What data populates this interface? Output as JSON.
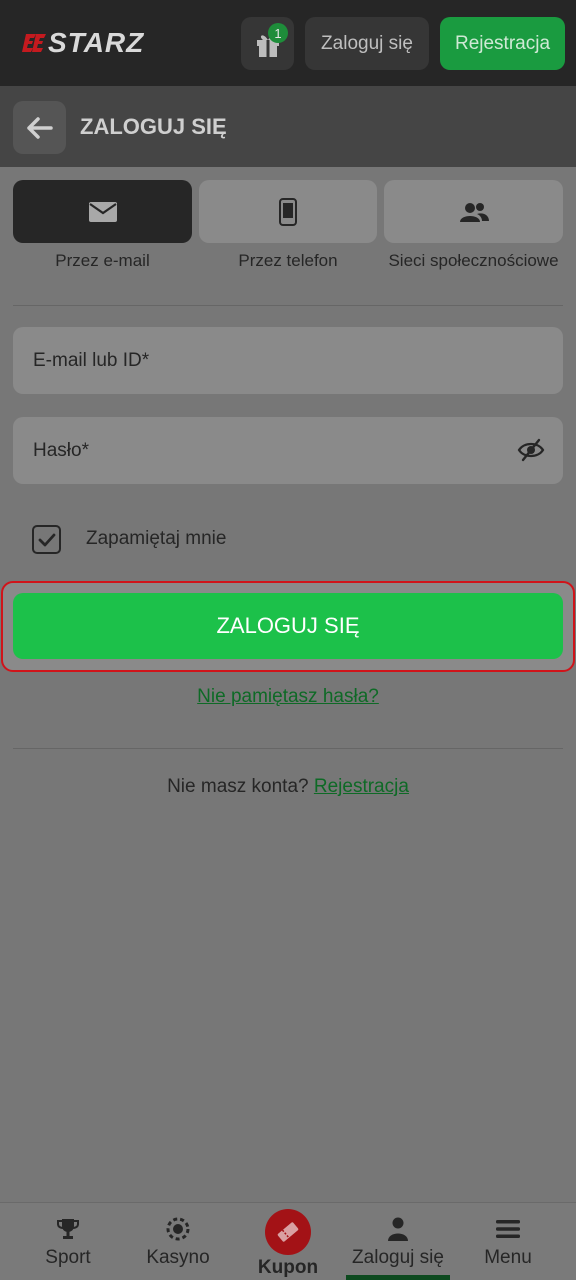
{
  "topbar": {
    "logo_text": "STARZ",
    "gift_badge": "1",
    "login_label": "Zaloguj się",
    "register_label": "Rejestracja"
  },
  "header": {
    "title": "ZALOGUJ SIĘ"
  },
  "methods": [
    {
      "label": "Przez e-mail",
      "icon": "envelope-icon",
      "active": true
    },
    {
      "label": "Przez telefon",
      "icon": "phone-icon",
      "active": false
    },
    {
      "label": "Sieci społecznościowe",
      "icon": "users-icon",
      "active": false
    }
  ],
  "form": {
    "email_placeholder": "E-mail lub ID*",
    "email_value": "",
    "password_placeholder": "Hasło*",
    "password_value": "",
    "remember_label": "Zapamiętaj mnie",
    "remember_checked": true,
    "submit_label": "ZALOGUJ SIĘ",
    "forgot_label": "Nie pamiętasz hasła?",
    "no_account_text": "Nie masz konta?",
    "register_link": "Rejestracja"
  },
  "bottom_nav": {
    "items": [
      {
        "label": "Sport",
        "icon": "trophy-icon"
      },
      {
        "label": "Kasyno",
        "icon": "casino-chip-icon"
      },
      {
        "label": "Kupon",
        "icon": "ticket-icon"
      },
      {
        "label": "Zaloguj się",
        "icon": "user-icon",
        "active": true
      },
      {
        "label": "Menu",
        "icon": "menu-icon"
      }
    ]
  },
  "colors": {
    "accent_green": "#1cc14a",
    "highlight_red": "#d0141a",
    "dark": "#262626"
  }
}
